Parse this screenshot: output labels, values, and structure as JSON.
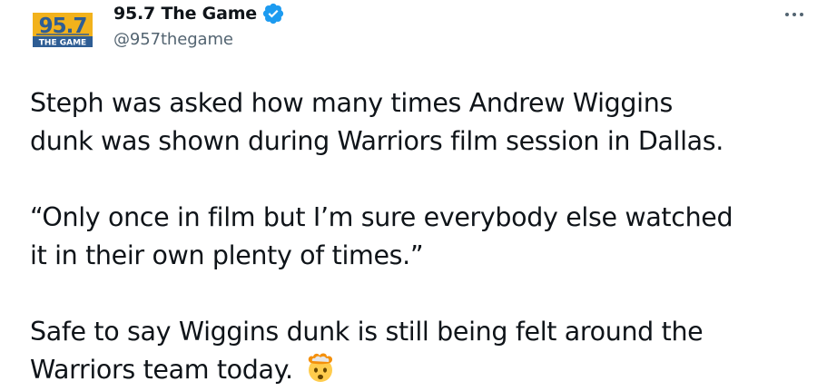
{
  "author": {
    "display_name": "95.7 The Game",
    "handle": "@957thegame",
    "verified": true,
    "avatar": {
      "number_text": "95.7",
      "subtitle_text": "THE GAME",
      "colors": {
        "primary": "#2e5d94",
        "accent": "#f2b21c"
      }
    }
  },
  "menu": {
    "icon": "more-horizontal-icon"
  },
  "tweet": {
    "paragraphs": [
      [
        "Steph was asked how many times Andrew Wiggins",
        "dunk was shown during Warriors film session in Dallas."
      ],
      [
        "“Only once in film but I’m sure everybody else watched",
        "it in their own plenty of times.”"
      ],
      [
        "Safe to say Wiggins dunk is still being felt around the",
        "Warriors team today."
      ]
    ],
    "emoji": "exploding-head-emoji"
  },
  "colors": {
    "text": "#0f1419",
    "secondary_text": "#536471",
    "verified_badge": "#1d9bf0",
    "background": "#ffffff"
  }
}
